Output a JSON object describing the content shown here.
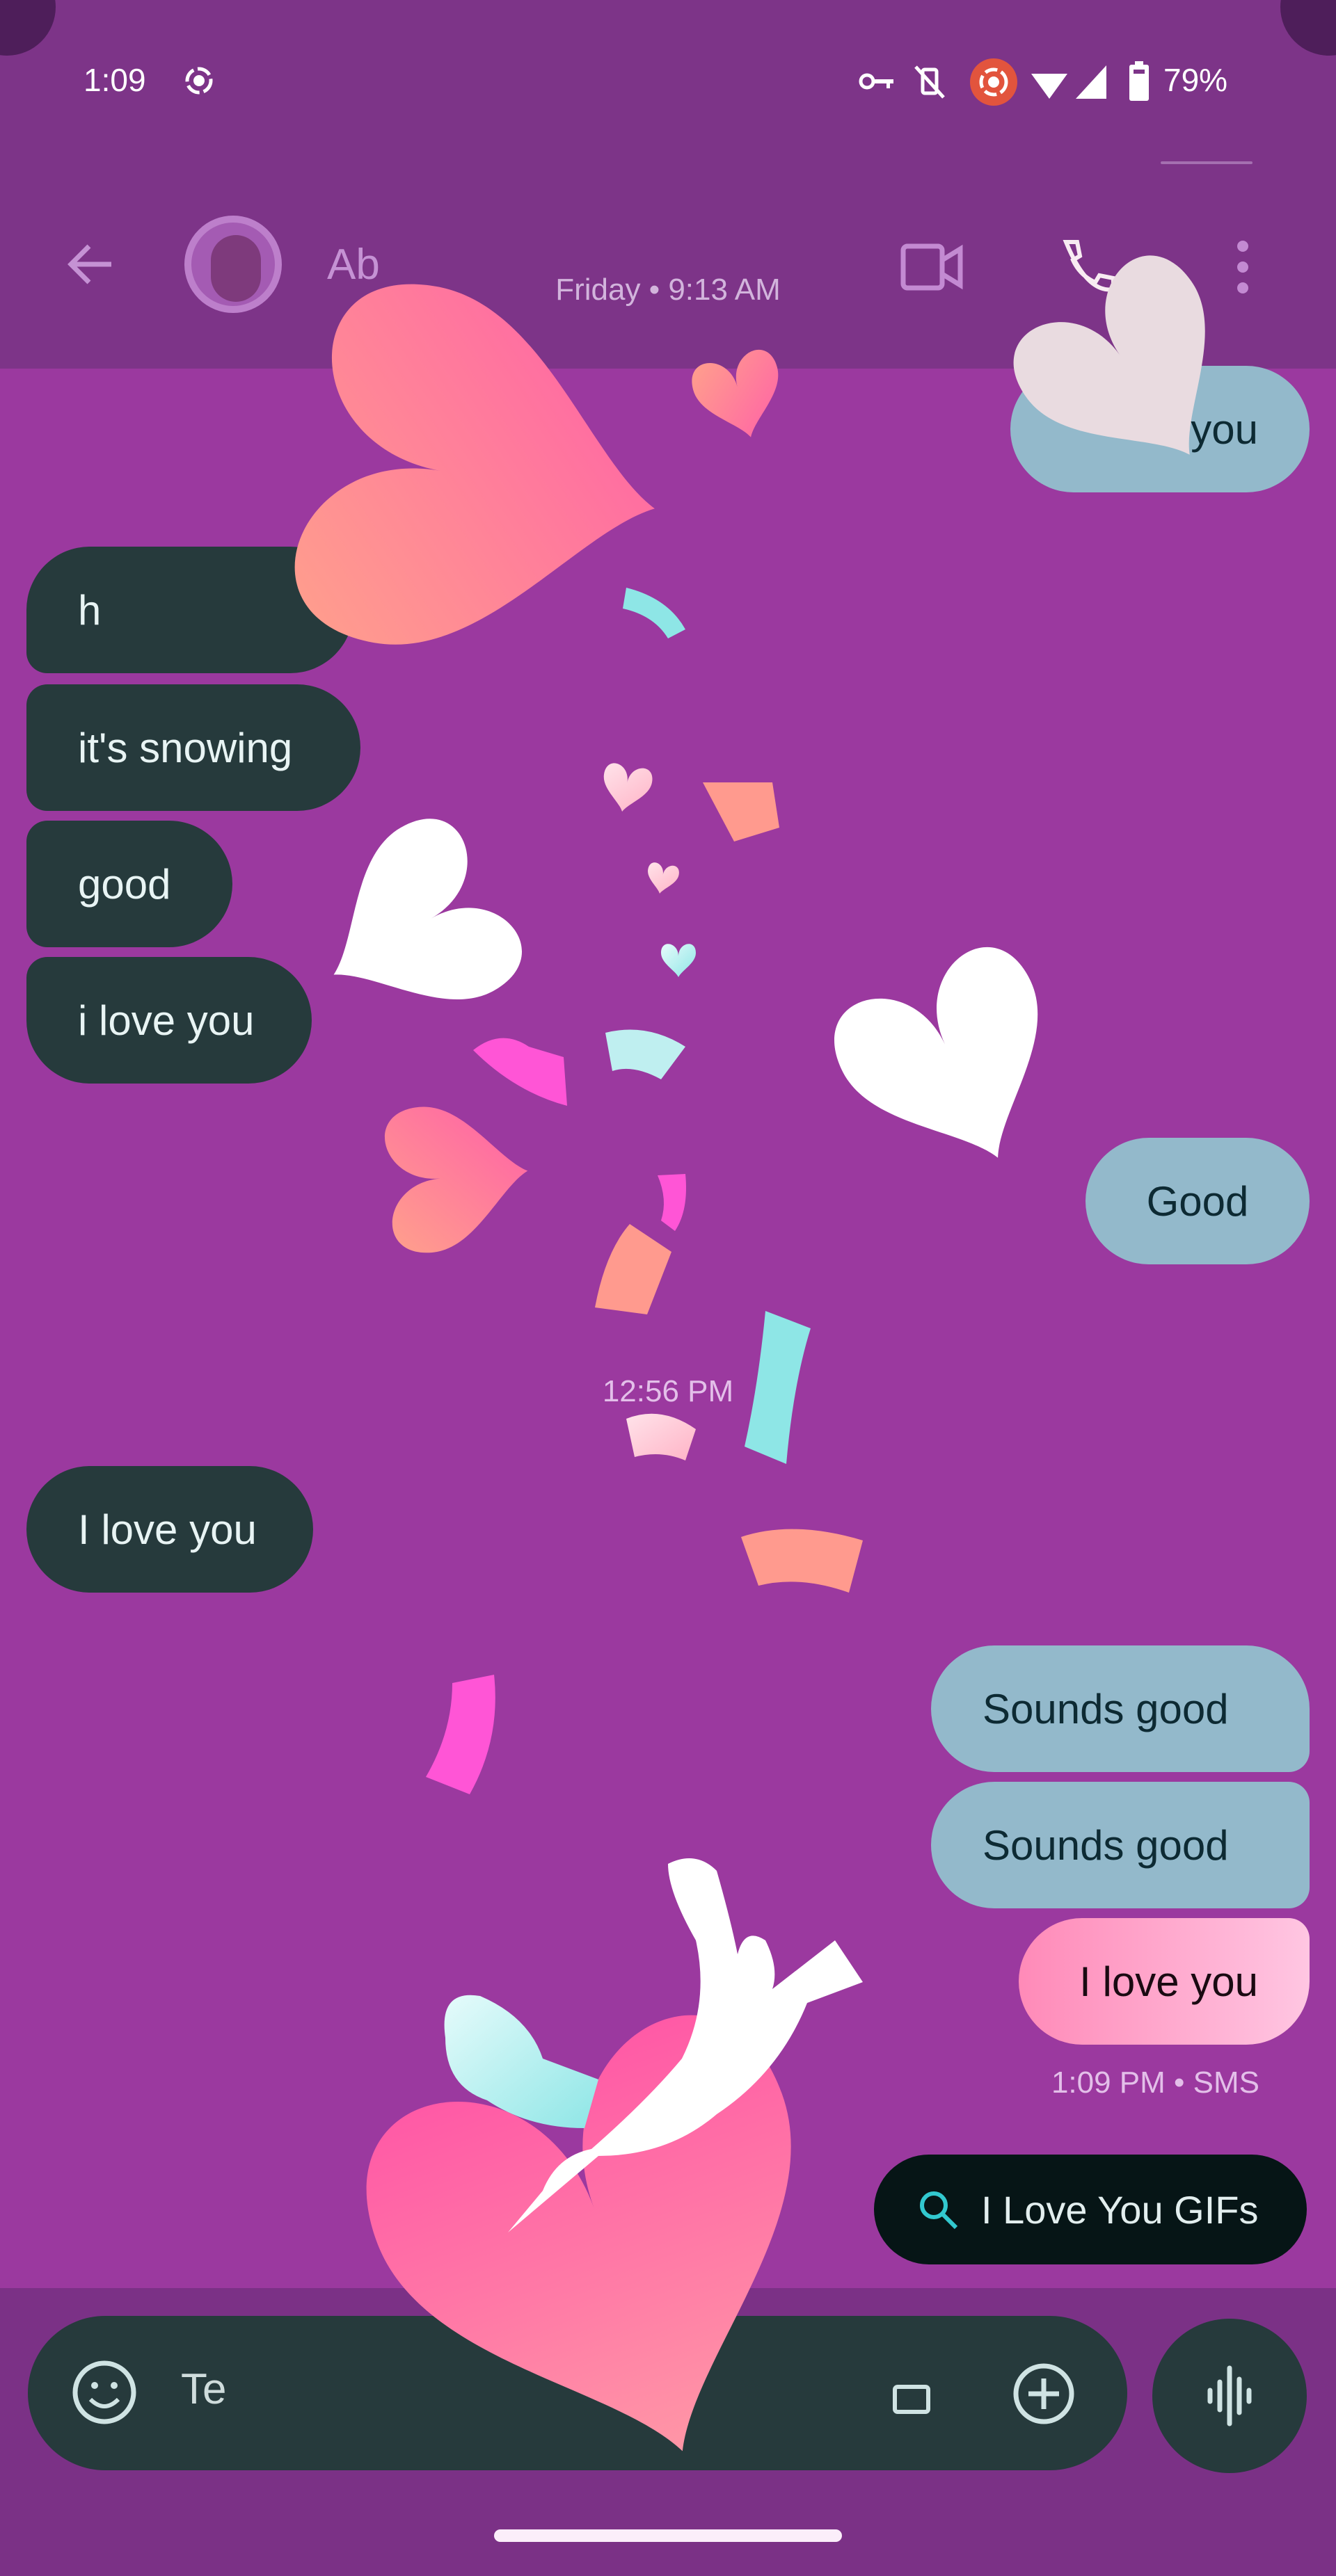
{
  "status_bar": {
    "time": "1:09",
    "battery": "79%",
    "icons": [
      "screen-record-icon",
      "vpn-key-icon",
      "vibrate-off-icon",
      "cast-record-icon",
      "wifi-icon",
      "signal-icon",
      "battery-icon"
    ]
  },
  "header": {
    "back_icon": "arrow-left-icon",
    "contact_name": "Ab",
    "actions": [
      "video-call-icon",
      "phone-icon",
      "more-vert-icon"
    ]
  },
  "conversation": {
    "date_separator": "Friday • 9:13 AM",
    "messages_top": [
      {
        "direction": "out",
        "text": "i love you",
        "visible_text": "you"
      },
      {
        "direction": "in",
        "text": "h",
        "visible_text": "h"
      },
      {
        "direction": "in",
        "text": "it's snowing"
      },
      {
        "direction": "in",
        "text": "good"
      },
      {
        "direction": "in",
        "text": "i love you"
      },
      {
        "direction": "out",
        "text": "Good"
      }
    ],
    "time_separator": "12:56 PM",
    "messages_bottom": [
      {
        "direction": "in",
        "text": "I love you"
      },
      {
        "direction": "out",
        "text": "Sounds good"
      },
      {
        "direction": "out",
        "text": "Sounds good"
      },
      {
        "direction": "out",
        "text": "I love you",
        "effect": "love"
      }
    ],
    "last_status": "1:09 PM • SMS"
  },
  "suggestion": {
    "icon": "search-icon",
    "label": "I Love You GIFs"
  },
  "compose": {
    "placeholder_visible": "Te",
    "emoji_icon": "emoji-icon",
    "gallery_icon": "image-icon",
    "add_icon": "add-circle-icon",
    "voice_icon": "voice-wave-icon"
  },
  "effect": {
    "name": "love-hearts-animation",
    "colors": {
      "background": "#9b399f",
      "pink": "#ff62a6",
      "peach": "#ff9a8e",
      "aqua": "#8ee6e6",
      "white": "#ffffff",
      "magenta": "#ff55d6"
    }
  }
}
